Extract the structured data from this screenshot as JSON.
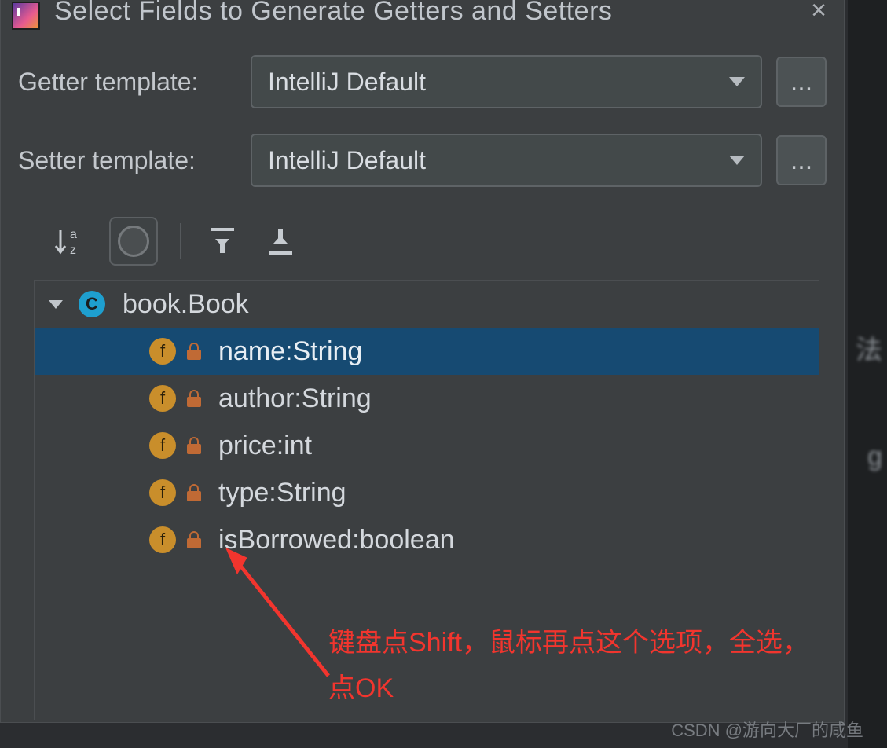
{
  "dialog": {
    "title": "Select Fields to Generate Getters and Setters",
    "close_glyph": "×"
  },
  "form": {
    "getter_label": "Getter template:",
    "getter_value": "IntelliJ Default",
    "setter_label": "Setter template:",
    "setter_value": "IntelliJ Default",
    "dots": "..."
  },
  "toolbar": {
    "sort_az": "a z",
    "expand_all": "expand",
    "collapse_all": "collapse"
  },
  "tree": {
    "class_icon_letter": "C",
    "field_icon_letter": "f",
    "class_name": "book.Book",
    "fields": [
      {
        "label": "name:String",
        "selected": true
      },
      {
        "label": "author:String",
        "selected": false
      },
      {
        "label": "price:int",
        "selected": false
      },
      {
        "label": "type:String",
        "selected": false
      },
      {
        "label": "isBorrowed:boolean",
        "selected": false
      }
    ]
  },
  "background": {
    "text1": "法",
    "text2": "g"
  },
  "annotation": {
    "line1": "键盘点Shift，鼠标再点这个选项，全选，",
    "line2": "点OK"
  },
  "watermark": "CSDN @游向大厂的咸鱼"
}
